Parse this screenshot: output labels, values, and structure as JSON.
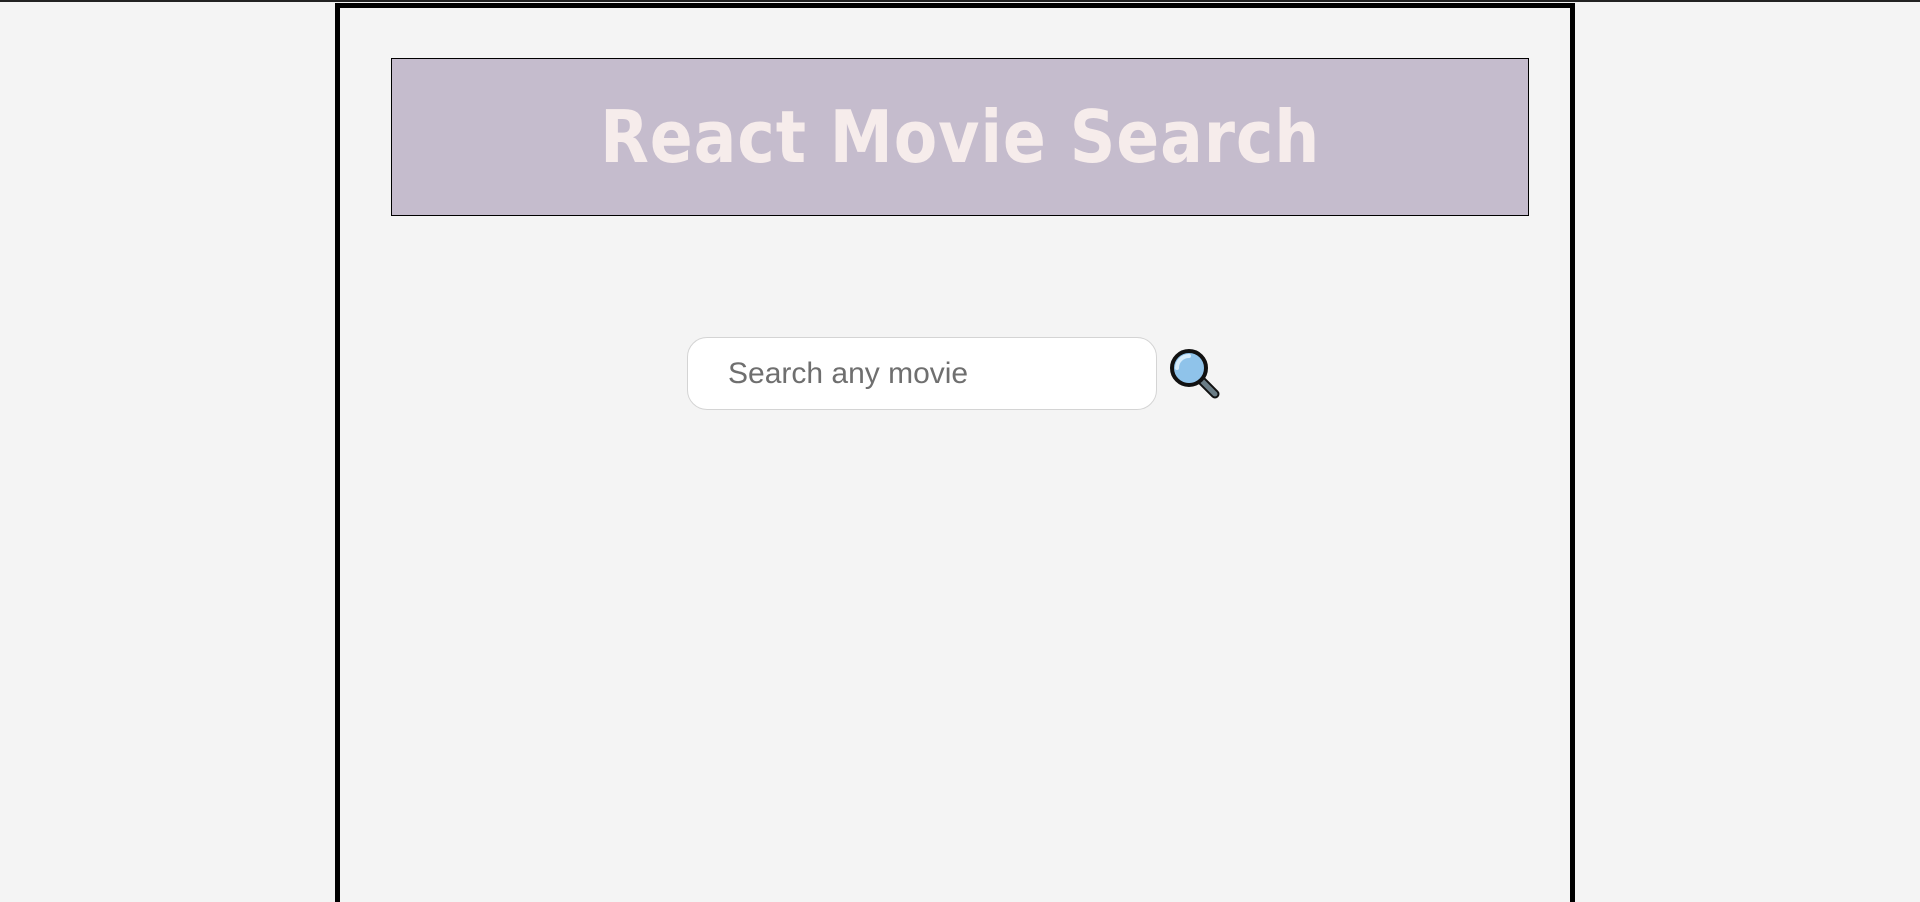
{
  "header": {
    "title": "React Movie Search"
  },
  "search": {
    "placeholder": "Search any movie",
    "value": "",
    "button_icon": "magnifying-glass-icon"
  },
  "colors": {
    "page_background": "#f4f4f4",
    "header_background": "#c5bccd",
    "title_color": "#f6eceb",
    "frame_border": "#000000"
  }
}
